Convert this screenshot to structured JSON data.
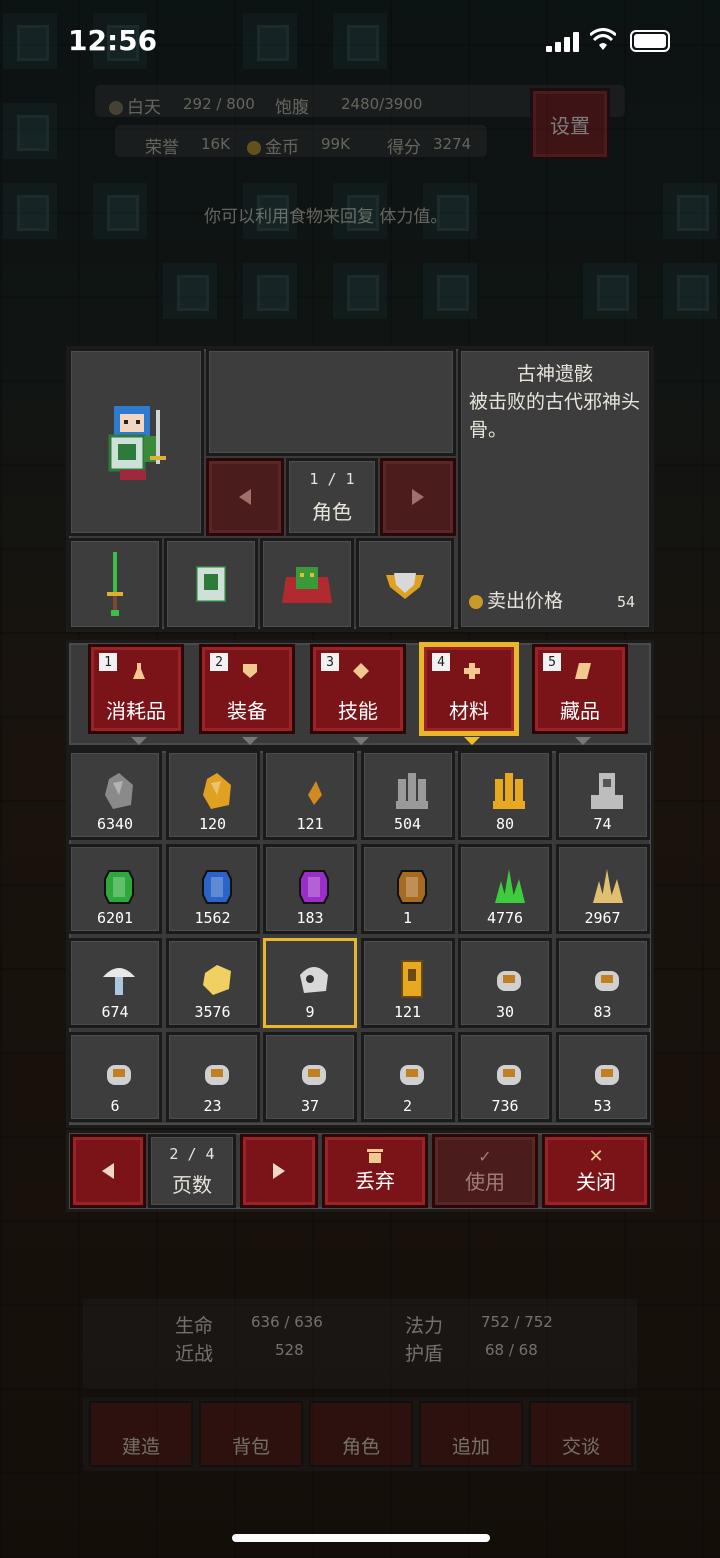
{
  "status_bar": {
    "time": "12:56"
  },
  "hud": {
    "day_label": "白天",
    "day_value": "292 / 800",
    "satiety_label": "饱腹",
    "satiety_value": "2480/3900",
    "honor_label": "荣誉",
    "honor_value": "16K",
    "gold_label": "金币",
    "gold_value": "99K",
    "score_label": "得分",
    "score_value": "3274",
    "settings_label": "设置",
    "tip": "你可以利用食物来回复",
    "tip_tail": "体力值。"
  },
  "character": {
    "pager": "1 / 1",
    "pager_label": "角色"
  },
  "description": {
    "title": "古神遗骸",
    "text": "被击败的古代邪神头骨。",
    "sell_label": "卖出价格",
    "sell_value": "54"
  },
  "tabs": [
    {
      "num": "1",
      "label": "消耗品",
      "icon": "potion-icon"
    },
    {
      "num": "2",
      "label": "装备",
      "icon": "shield-icon"
    },
    {
      "num": "3",
      "label": "技能",
      "icon": "diamond-icon"
    },
    {
      "num": "4",
      "label": "材料",
      "icon": "plus-icon",
      "active": true
    },
    {
      "num": "5",
      "label": "藏品",
      "icon": "scroll-icon"
    }
  ],
  "items": [
    {
      "icon": "gray-ore-icon",
      "count": "6340",
      "color": "#8a8a8a"
    },
    {
      "icon": "gold-ore-icon",
      "count": "120",
      "color": "#e0a020"
    },
    {
      "icon": "amber-shard-icon",
      "count": "121",
      "color": "#d08a20"
    },
    {
      "icon": "iron-ingot-icon",
      "count": "504",
      "color": "#9a9a9a"
    },
    {
      "icon": "gold-ingot-icon",
      "count": "80",
      "color": "#e8a820"
    },
    {
      "icon": "silver-idol-icon",
      "count": "74",
      "color": "#bdbdbd"
    },
    {
      "icon": "emerald-icon",
      "count": "6201",
      "color": "#2ea83a"
    },
    {
      "icon": "sapphire-icon",
      "count": "1562",
      "color": "#2a64c8"
    },
    {
      "icon": "amethyst-icon",
      "count": "183",
      "color": "#9a2ec8"
    },
    {
      "icon": "topaz-icon",
      "count": "1",
      "color": "#a86a20"
    },
    {
      "icon": "green-crystal-icon",
      "count": "4776",
      "color": "#3ccc3c"
    },
    {
      "icon": "gold-crystal-icon",
      "count": "2967",
      "color": "#e0c070"
    },
    {
      "icon": "mushroom-icon",
      "count": "674",
      "color": "#e8e8e8"
    },
    {
      "icon": "gold-nugget-icon",
      "count": "3576",
      "color": "#f0d060"
    },
    {
      "icon": "skull-relic-icon",
      "count": "9",
      "color": "#d8d8d8",
      "selected": true
    },
    {
      "icon": "gold-tablet-icon",
      "count": "121",
      "color": "#e8a820"
    },
    {
      "icon": "orange-rune-icon",
      "count": "30",
      "color": "#d0d0d0"
    },
    {
      "icon": "skull-rune-icon",
      "count": "83",
      "color": "#d0d0d0"
    },
    {
      "icon": "moon-rune-icon",
      "count": "6",
      "color": "#d0d0d0"
    },
    {
      "icon": "crown-rune-icon",
      "count": "23",
      "color": "#d0d0d0"
    },
    {
      "icon": "seven-rune-icon",
      "count": "37",
      "color": "#d0d0d0"
    },
    {
      "icon": "cross-rune-icon",
      "count": "2",
      "color": "#d0d0d0"
    },
    {
      "icon": "triangle-rune-icon",
      "count": "736",
      "color": "#d0d0d0"
    },
    {
      "icon": "bar-rune-icon",
      "count": "53",
      "color": "#d0d0d0"
    }
  ],
  "footer": {
    "page": "2 / 4",
    "page_label": "页数",
    "discard_label": "丢弃",
    "use_label": "使用",
    "close_label": "关闭"
  },
  "bottom_hud": {
    "hp_label": "生命",
    "hp_value": "636 / 636",
    "mp_label": "法力",
    "mp_value": "752 / 752",
    "melee_label": "近战",
    "melee_value": "528",
    "armor_label": "护盾",
    "armor_value": "68 / 68",
    "nav": [
      "建造",
      "背包",
      "角色",
      "追加",
      "交谈"
    ]
  }
}
